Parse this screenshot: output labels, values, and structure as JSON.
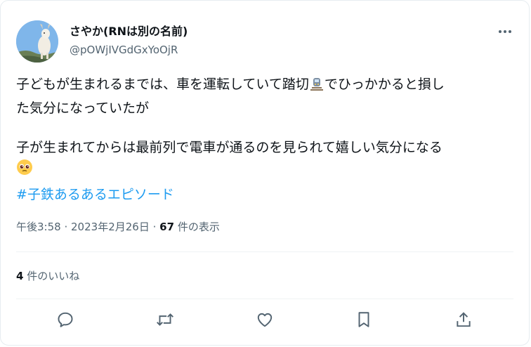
{
  "tweet": {
    "display_name": "さやか(RNは別の名前)",
    "handle": "@pOWjIVGdGxYoOjR",
    "line1a": "子どもが生まれるまでは、車を運転していて踏切",
    "line1b": "でひっかかると損し",
    "line2": "た気分になっていたが",
    "line3": "子が生まれてからは最前列で電車が通るのを見られて嬉しい気分になる",
    "hashtag": "#子鉄あるあるエピソード",
    "time": "午後3:58",
    "date": "2023年2月26日",
    "views_count": "67",
    "views_label": "件の表示",
    "likes_count": "4",
    "likes_label": "件のいいね"
  },
  "icons": {
    "more": "more-dots-icon",
    "train_emoji": "train-track-emoji",
    "pleading_emoji": "pleading-face-emoji",
    "reply": "reply-bubble-icon",
    "retweet": "retweet-icon",
    "like": "heart-icon",
    "bookmark": "bookmark-icon",
    "share": "share-upload-icon"
  },
  "colors": {
    "text": "#0f1419",
    "secondary": "#536471",
    "link": "#1d9bf0",
    "divider": "#eff3f4"
  }
}
